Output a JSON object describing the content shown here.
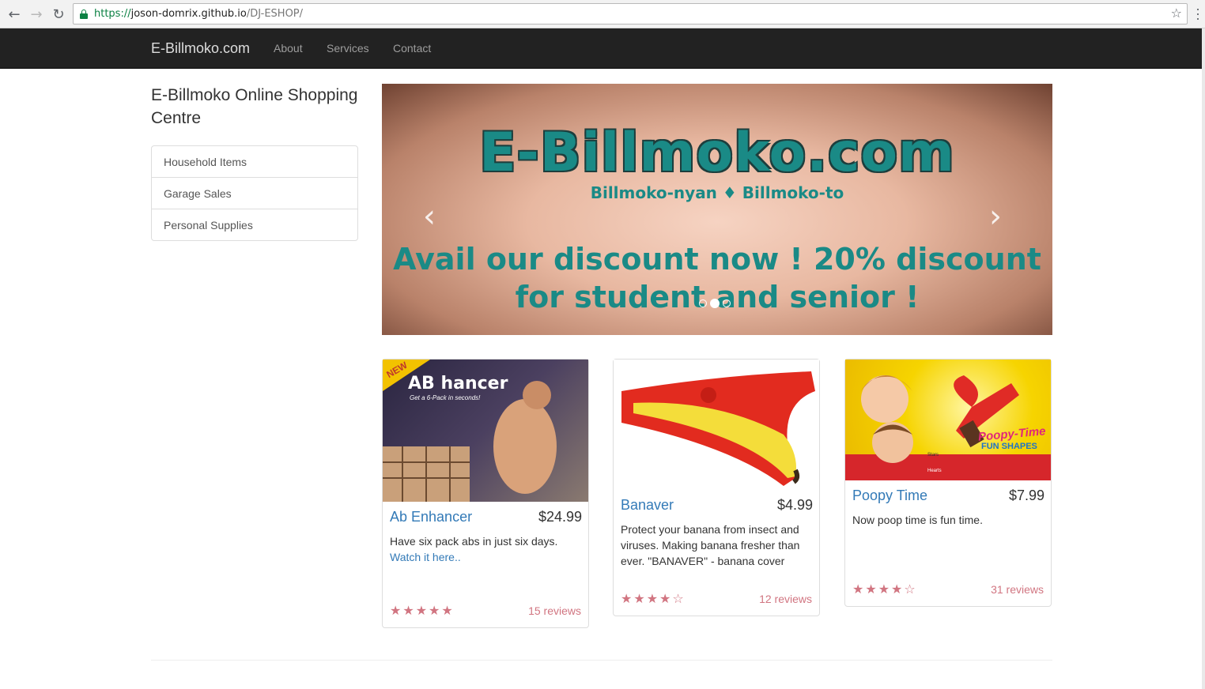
{
  "browser": {
    "url_scheme": "https://",
    "url_host": "joson-domrix.github.io",
    "url_path": "/DJ-ESHOP/"
  },
  "navbar": {
    "brand": "E-Billmoko.com",
    "links": [
      "About",
      "Services",
      "Contact"
    ]
  },
  "sidebar": {
    "title": "E-Billmoko Online Shopping Centre",
    "items": [
      "Household Items",
      "Garage Sales",
      "Personal Supplies"
    ]
  },
  "carousel": {
    "title": "E-Billmoko.com",
    "subtitle": "Billmoko-nyan ♦ Billmoko-to",
    "promo_line1": "Avail our discount now ! 20% discount",
    "promo_line2": "for student and senior !",
    "prev": "‹",
    "next": "›",
    "slide_count": 3,
    "active_slide": 2
  },
  "products": [
    {
      "image_label": "AB hancer",
      "image_badge": "NEW",
      "image_tagline": "Get a 6-Pack in seconds!",
      "name": "Ab Enhancer",
      "price": "$24.99",
      "description": "Have six pack abs in just six days.",
      "link": "Watch it here..",
      "stars": "★★★★★",
      "rating": 5,
      "reviews": "15 reviews"
    },
    {
      "name": "Banaver",
      "price": "$4.99",
      "description": "Protect your banana from insect and viruses. Making banana fresher than ever. \"BANAVER\" - banana cover",
      "stars": "★★★★☆",
      "rating": 4,
      "reviews": "12 reviews"
    },
    {
      "image_label": "Poopy-Time",
      "image_sublabel": "FUN SHAPES",
      "image_tag_stars": "Stars",
      "image_tag_hearts": "Hearts",
      "name": "Poopy Time",
      "price": "$7.99",
      "description": "Now poop time is fun time.",
      "stars": "★★★★☆",
      "rating": 4,
      "reviews": "31 reviews"
    }
  ],
  "colors": {
    "navbar_bg": "#222222",
    "link": "#337ab7",
    "rating": "#d17581",
    "banner_text": "#1a8a86"
  }
}
